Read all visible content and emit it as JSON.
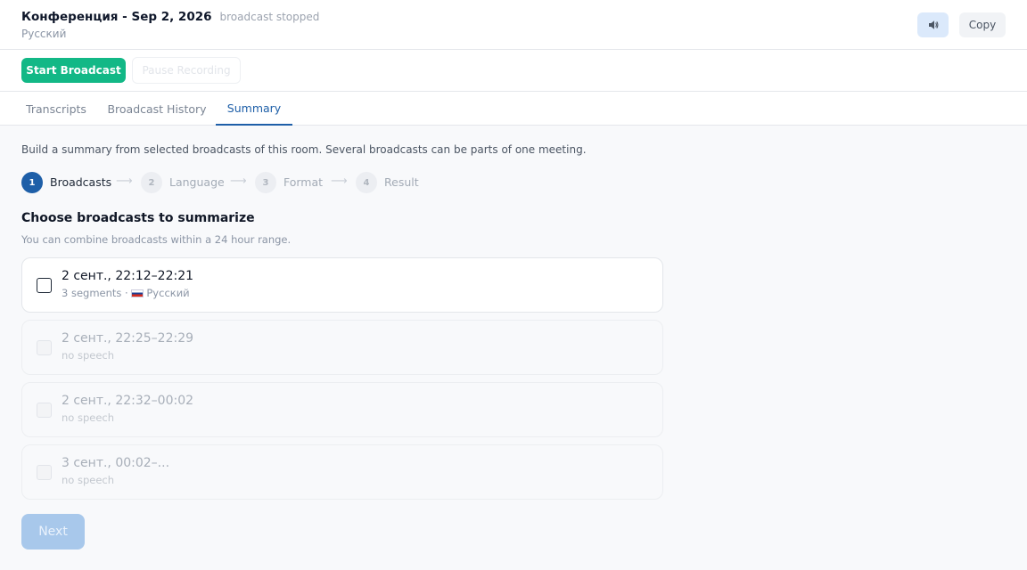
{
  "header": {
    "title": "Конференция - Sep 2, 2026",
    "status": "broadcast stopped",
    "language": "Русский",
    "speaker_icon": "speaker-icon",
    "copy_label": "Copy"
  },
  "toolbar": {
    "start_label": "Start Broadcast",
    "pause_label": "Pause Recording"
  },
  "tabs": [
    {
      "label": "Transcripts",
      "active": false
    },
    {
      "label": "Broadcast History",
      "active": false
    },
    {
      "label": "Summary",
      "active": true
    }
  ],
  "summary": {
    "intro": "Build a summary from selected broadcasts of this room. Several broadcasts can be parts of one meeting.",
    "steps": [
      {
        "num": "1",
        "label": "Broadcasts",
        "active": true
      },
      {
        "num": "2",
        "label": "Language",
        "active": false
      },
      {
        "num": "3",
        "label": "Format",
        "active": false
      },
      {
        "num": "4",
        "label": "Result",
        "active": false
      }
    ],
    "step_arrow": "⟶",
    "section_title": "Choose broadcasts to summarize",
    "section_hint": "You can combine broadcasts within a 24 hour range.",
    "broadcasts": [
      {
        "title": "2 сент., 22:12–22:21",
        "sub_prefix": "3 segments · ",
        "sub_lang": "Русский",
        "flag": "ru-flag",
        "enabled": true,
        "checked": false
      },
      {
        "title": "2 сент., 22:25–22:29",
        "sub": "no speech",
        "enabled": false,
        "checked": false
      },
      {
        "title": "2 сент., 22:32–00:02",
        "sub": "no speech",
        "enabled": false,
        "checked": false
      },
      {
        "title": "3 сент., 00:02–...",
        "sub": "no speech",
        "enabled": false,
        "checked": false
      }
    ],
    "next_label": "Next"
  },
  "colors": {
    "accent": "#1e5fa8",
    "start_button": "#12b886",
    "next_disabled": "#a8c8eb"
  }
}
